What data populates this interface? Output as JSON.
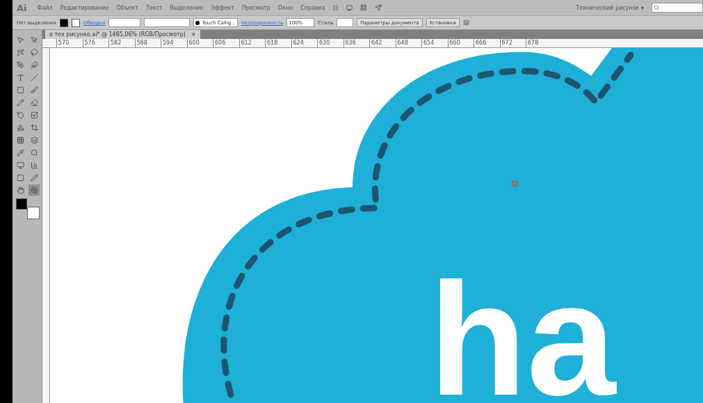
{
  "app": {
    "logo": "Ai"
  },
  "menu": [
    "Файл",
    "Редактирование",
    "Объект",
    "Текст",
    "Выделение",
    "Эффект",
    "Просмотр",
    "Окно",
    "Справка"
  ],
  "workspace": {
    "label": "Технический рисунок",
    "caret": "▾"
  },
  "control_bar": {
    "selection": "Нет выделения",
    "stroke_label": "Обводка",
    "brush": "Touch Callig...",
    "opacity_label": "Непрозрачность",
    "opacity": "100%",
    "style_label": "Стиль",
    "buttons": [
      "Параметры документа",
      "Установки"
    ]
  },
  "document_tab": {
    "title": "о тех рисунке.ai* @ 1465,06% (RGB/Просмотр)",
    "close": "×",
    "selected": true
  },
  "ruler": [
    "570",
    "576",
    "582",
    "588",
    "594",
    "600",
    "606",
    "612",
    "618",
    "624",
    "630",
    "636",
    "642",
    "648",
    "654",
    "660",
    "666",
    "672",
    "678"
  ],
  "artwork": {
    "text": "ha"
  }
}
